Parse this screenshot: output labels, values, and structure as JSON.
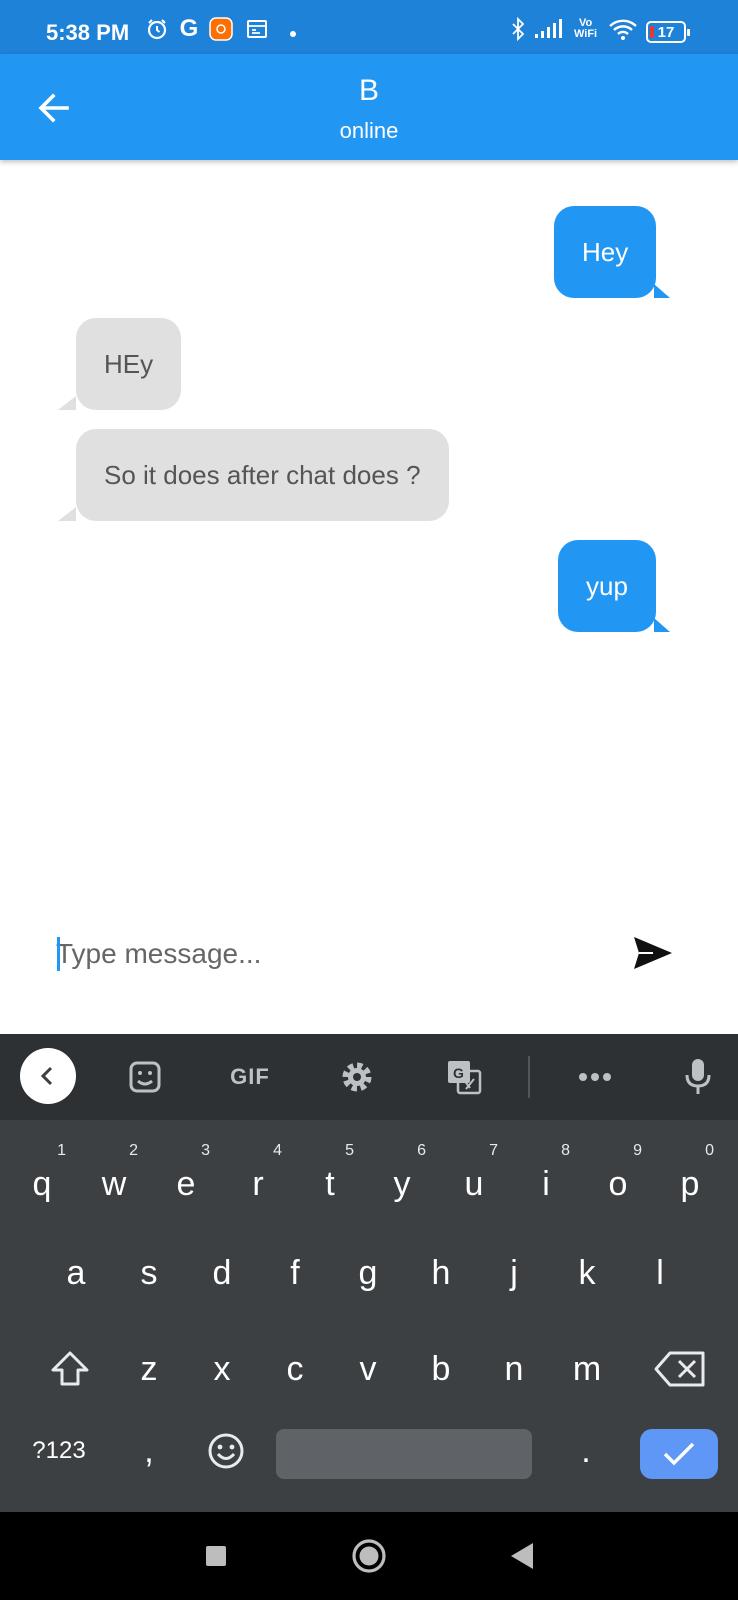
{
  "status_bar": {
    "time": "5:38 PM",
    "g_letter": "G",
    "vo_label": "Vo",
    "wifi_label": "WiFi",
    "battery_level": "17"
  },
  "header": {
    "contact_name": "B",
    "contact_status": "online"
  },
  "messages": [
    {
      "text": "Hey",
      "direction": "sent"
    },
    {
      "text": "HEy",
      "direction": "received"
    },
    {
      "text": "So it does after chat does ?",
      "direction": "received"
    },
    {
      "text": "yup",
      "direction": "sent"
    }
  ],
  "composer": {
    "placeholder": "Type message..."
  },
  "keyboard": {
    "gif_label": "GIF",
    "row1": [
      {
        "key": "q",
        "hint": "1"
      },
      {
        "key": "w",
        "hint": "2"
      },
      {
        "key": "e",
        "hint": "3"
      },
      {
        "key": "r",
        "hint": "4"
      },
      {
        "key": "t",
        "hint": "5"
      },
      {
        "key": "y",
        "hint": "6"
      },
      {
        "key": "u",
        "hint": "7"
      },
      {
        "key": "i",
        "hint": "8"
      },
      {
        "key": "o",
        "hint": "9"
      },
      {
        "key": "p",
        "hint": "0"
      }
    ],
    "row2": [
      "a",
      "s",
      "d",
      "f",
      "g",
      "h",
      "j",
      "k",
      "l"
    ],
    "row3": [
      "z",
      "x",
      "c",
      "v",
      "b",
      "n",
      "m"
    ],
    "symbols_label": "?123",
    "comma": ",",
    "period": "."
  },
  "colors": {
    "app_bar": "#2196F3",
    "status_bar": "#1E82D8",
    "sent_bubble": "#2196F3",
    "received_bubble": "#E0E0E0",
    "keyboard_bg": "#3C4043",
    "enter_key": "#5E97F6"
  },
  "icons": {
    "status": [
      "alarm-icon",
      "g-icon",
      "app-notification-icon",
      "calendar-icon",
      "bluetooth-icon",
      "signal-icon",
      "wifi-icon",
      "battery-icon"
    ],
    "header": "arrow-back-icon",
    "composer": "send-icon",
    "keyboard": [
      "chevron-left-icon",
      "sticker-icon",
      "settings-icon",
      "translate-icon",
      "more-icon",
      "mic-icon",
      "shift-icon",
      "backspace-icon",
      "emoji-icon",
      "check-icon"
    ],
    "nav": [
      "recents-icon",
      "home-icon",
      "back-icon"
    ]
  }
}
